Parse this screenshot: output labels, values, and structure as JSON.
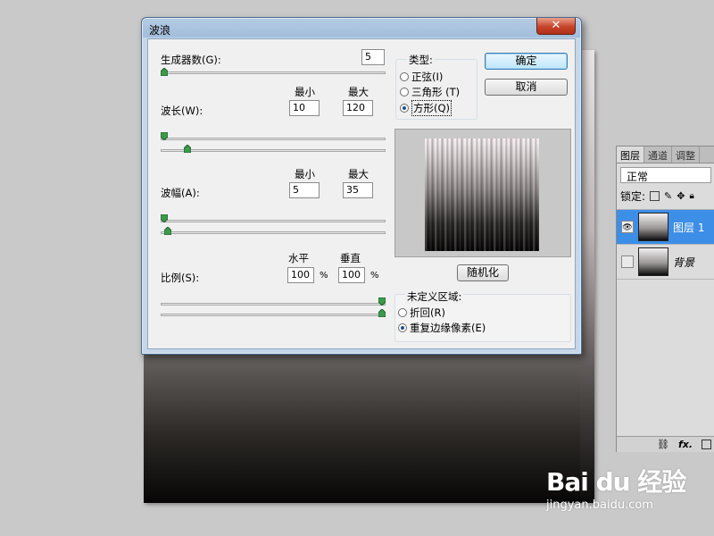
{
  "dialog": {
    "title": "波浪",
    "close_glyph": "✕",
    "generators_label": "生成器数(G):",
    "generators_value": "5",
    "wavelength_label": "波长(W):",
    "wavelength_min_header": "最小",
    "wavelength_max_header": "最大",
    "wavelength_min": "10",
    "wavelength_max": "120",
    "amplitude_label": "波幅(A):",
    "amplitude_min_header": "最小",
    "amplitude_max_header": "最大",
    "amplitude_min": "5",
    "amplitude_max": "35",
    "scale_label": "比例(S):",
    "scale_h_header": "水平",
    "scale_v_header": "垂直",
    "scale_h": "100",
    "scale_v": "100",
    "percent": "%",
    "type_group_label": "类型:",
    "type_options": [
      "正弦(I)",
      "三角形 (T)",
      "方形(Q)"
    ],
    "type_selected": "方形(Q)",
    "ok_label": "确定",
    "cancel_label": "取消",
    "randomize_label": "随机化",
    "undefined_group_label": "未定义区域:",
    "undefined_options": [
      "折回(R)",
      "重复边缘像素(E)"
    ],
    "undefined_selected": "重复边缘像素(E)"
  },
  "layers_panel": {
    "tabs": [
      "图层",
      "通道",
      "调整"
    ],
    "blend_mode": "正常",
    "lock_label": "锁定:",
    "layers": [
      {
        "name": "图层 1",
        "selected": true,
        "visible": true
      },
      {
        "name": "背景",
        "selected": false,
        "visible": false
      }
    ],
    "footer_fx": "fx."
  },
  "watermark": {
    "logo": "Bai du 经验",
    "url": "jingyan.baidu.com"
  },
  "colors": {
    "title_bar": "#a2bedb",
    "close_button": "#c7432b",
    "selected_layer": "#3d8ee6"
  }
}
